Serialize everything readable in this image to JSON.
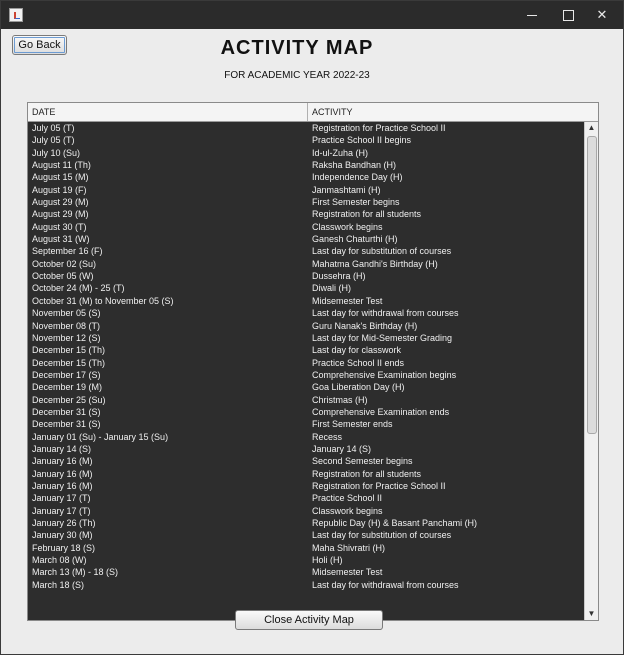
{
  "window": {
    "controls": {
      "minimize": "—",
      "maximize": "",
      "close": "✕"
    }
  },
  "buttons": {
    "go_back": "Go Back",
    "close_map": "Close Activity Map"
  },
  "header": {
    "title": "ACTIVITY MAP",
    "subtitle": "FOR ACADEMIC YEAR 2022-23"
  },
  "table": {
    "columns": [
      "DATE",
      "ACTIVITY"
    ],
    "rows": [
      [
        "July 05 (T)",
        "Registration for Practice School II"
      ],
      [
        "July 05 (T)",
        "Practice School II begins"
      ],
      [
        "July 10 (Su)",
        "Id-ul-Zuha (H)"
      ],
      [
        "August 11 (Th)",
        "Raksha Bandhan (H)"
      ],
      [
        "August 15 (M)",
        "Independence Day (H)"
      ],
      [
        "August 19 (F)",
        "Janmashtami (H)"
      ],
      [
        "August 29 (M)",
        "First Semester begins"
      ],
      [
        "August 29 (M)",
        "Registration for all students"
      ],
      [
        "August 30 (T)",
        "Classwork begins"
      ],
      [
        "August 31 (W)",
        "Ganesh Chaturthi (H)"
      ],
      [
        "September 16 (F)",
        "Last day for substitution of courses"
      ],
      [
        "October 02 (Su)",
        "Mahatma Gandhi's Birthday (H)"
      ],
      [
        "October 05 (W)",
        "Dussehra (H)"
      ],
      [
        "October 24 (M) - 25 (T)",
        "Diwali (H)"
      ],
      [
        "October 31 (M) to November 05 (S)",
        "Midsemester Test"
      ],
      [
        "November 05 (S)",
        "Last day for withdrawal from courses"
      ],
      [
        "November 08 (T)",
        "Guru Nanak's Birthday (H)"
      ],
      [
        "November 12 (S)",
        "Last day for Mid-Semester Grading"
      ],
      [
        "December 15 (Th)",
        "Last day for classwork"
      ],
      [
        "December 15 (Th)",
        "Practice School II ends"
      ],
      [
        "December 17 (S)",
        "Comprehensive Examination begins"
      ],
      [
        "December 19 (M)",
        "Goa Liberation Day (H)"
      ],
      [
        "December 25 (Su)",
        "Christmas (H)"
      ],
      [
        "December 31 (S)",
        "Comprehensive Examination ends"
      ],
      [
        "December 31 (S)",
        "First Semester ends"
      ],
      [
        "January 01 (Su) - January 15 (Su)",
        "Recess"
      ],
      [
        "January 14 (S)",
        "January 14 (S)"
      ],
      [
        "January 16 (M)",
        "Second Semester begins"
      ],
      [
        "January 16 (M)",
        "Registration for all students"
      ],
      [
        "January 16 (M)",
        "Registration for Practice School II"
      ],
      [
        "January 17 (T)",
        "Practice School II"
      ],
      [
        "January 17 (T)",
        "Classwork begins"
      ],
      [
        "January 26 (Th)",
        "Republic Day (H) & Basant Panchami (H)"
      ],
      [
        "January 30 (M)",
        "Last day for substitution of courses"
      ],
      [
        "February 18 (S)",
        "Maha Shivratri (H)"
      ],
      [
        "March 08 (W)",
        "Holi (H)"
      ],
      [
        "March 13 (M) - 18 (S)",
        "Midsemester Test"
      ],
      [
        "March 18 (S)",
        "Last day for withdrawal from courses"
      ]
    ]
  },
  "scrollbar": {
    "up": "▲",
    "down": "▼"
  }
}
